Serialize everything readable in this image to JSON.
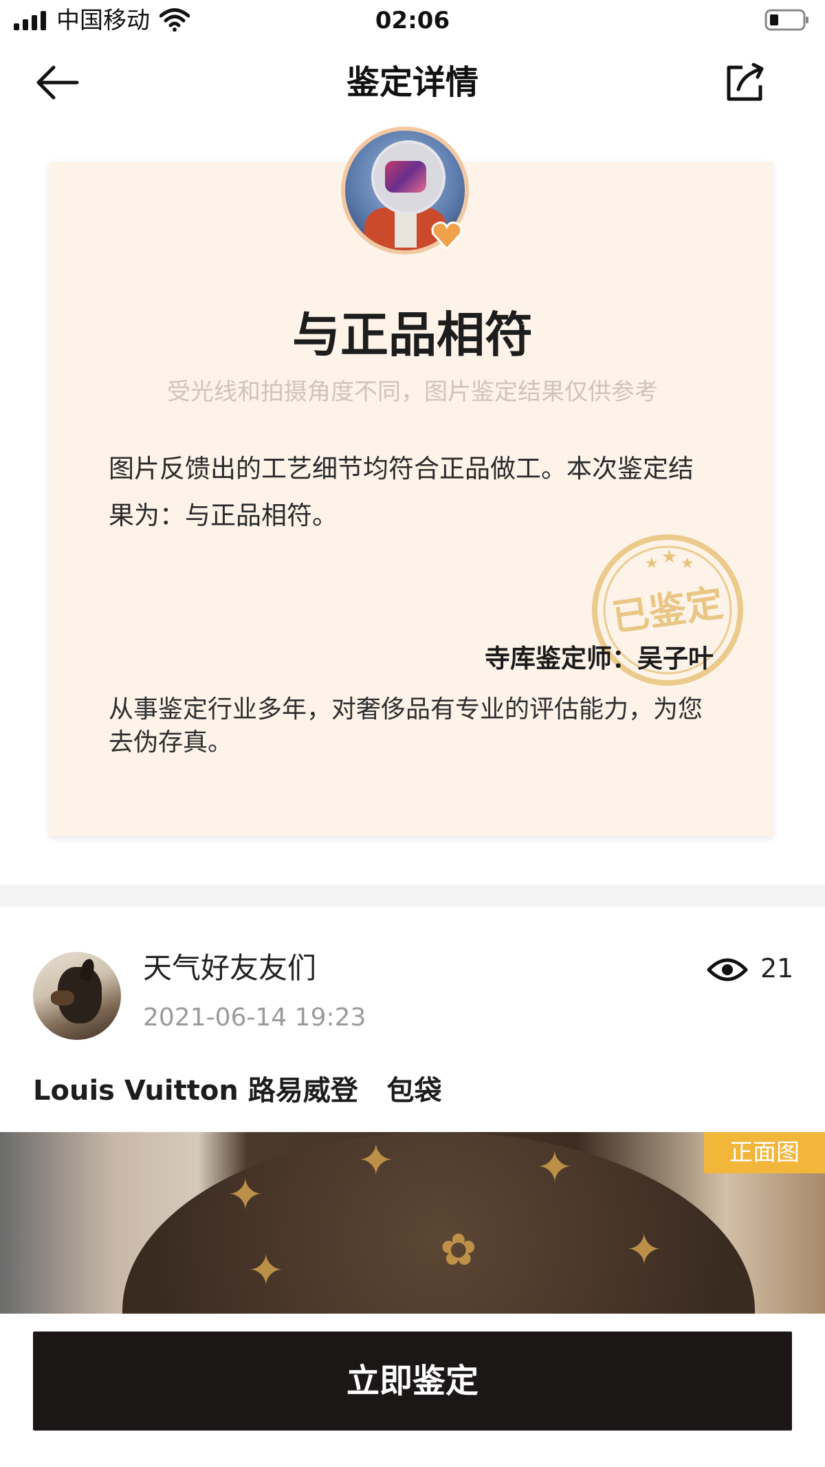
{
  "status_bar": {
    "carrier": "中国移动",
    "time": "02:06"
  },
  "nav": {
    "title": "鉴定详情"
  },
  "result": {
    "verdict": "与正品相符",
    "disclaimer": "受光线和拍摄角度不同，图片鉴定结果仅供参考",
    "summary": "图片反馈出的工艺细节均符合正品做工。本次鉴定结果为：与正品相符。",
    "seal_text": "已鉴定",
    "appraiser": "寺库鉴定师：吴子叶",
    "bio": "从事鉴定行业多年，对奢侈品有专业的评估能力，为您去伪存真。"
  },
  "post": {
    "username": "天气好友友们",
    "timestamp": "2021-06-14 19:23",
    "views": "21",
    "title": "Louis Vuitton 路易威登   包袋",
    "photo_tag": "正面图"
  },
  "action": {
    "label": "立即鉴定"
  },
  "colors": {
    "card_bg": "#fdf3e9",
    "seal": "#e7c27a",
    "tag": "#f2b63a",
    "button": "#1b1717"
  },
  "icons": {
    "back": "arrow-left-icon",
    "share": "share-icon",
    "views": "eye-icon",
    "badge": "heart-badge-icon"
  }
}
